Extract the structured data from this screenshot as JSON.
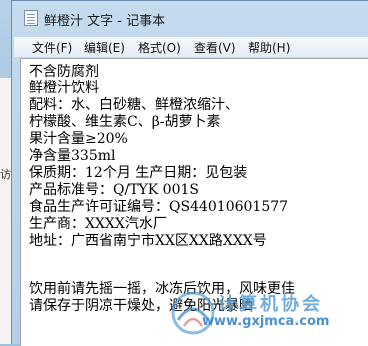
{
  "background": {
    "side_text": "访问"
  },
  "window": {
    "title": "鲜橙汁 文字 - 记事本",
    "icon": "notepad-icon"
  },
  "menu": [
    {
      "label": "文件(F)"
    },
    {
      "label": "编辑(E)"
    },
    {
      "label": "格式(O)"
    },
    {
      "label": "查看(V)"
    },
    {
      "label": "帮助(H)"
    }
  ],
  "content": {
    "lines": [
      "不含防腐剂",
      "鲜橙汁饮料",
      "配料：水、白砂糖、鲜橙浓缩汁、",
      "柠檬酸、维生素C、β-胡萝卜素",
      "果汁含量≥20%",
      "净含量335ml",
      "保质期：12个月 生产日期：见包装",
      "产品标准号：Q/TYK 001S",
      "食品生产许可证编号：QS44010601577",
      "生产商：XXXX汽水厂",
      "地址：广西省南宁市XX区XX路XXX号",
      "",
      "",
      "饮用前请先摇一摇，冰冻后饮用，风味更佳",
      "请保存于阴凉干燥处，避免阳光暴晒"
    ]
  },
  "watermark": {
    "title": "计算机协会",
    "url": "www.gxjmca.com"
  },
  "colors": {
    "title_bg": "#b4cfe6",
    "editor_bg": "#ffffff",
    "watermark": "#3b86c6"
  }
}
